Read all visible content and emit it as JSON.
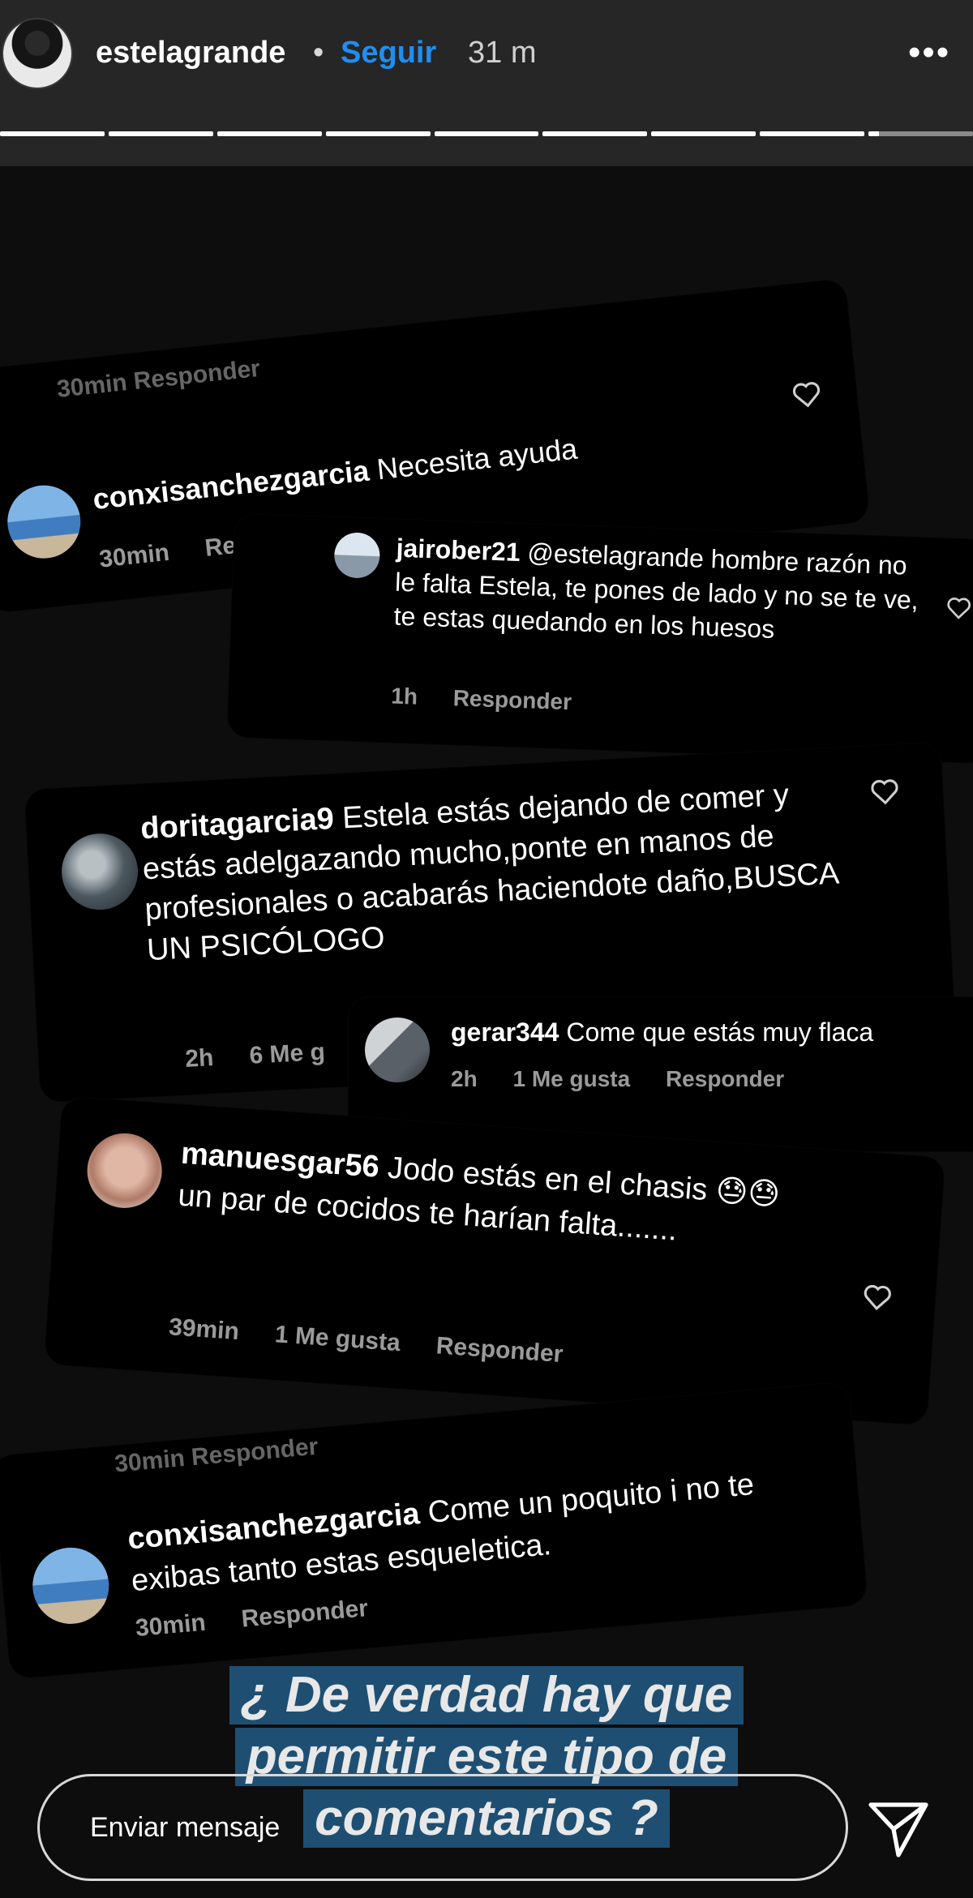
{
  "header": {
    "username": "estelagrande",
    "separator": "•",
    "follow_label": "Seguir",
    "time_ago": "31 m",
    "more_icon": "more-horizontal-icon",
    "progress_segments": 9,
    "progress_current_fraction": 0.1
  },
  "comments": [
    {
      "ghost_meta": "30min   Responder",
      "username": "conxisanchezgarcia",
      "text": "Necesita ayuda",
      "time": "30min",
      "reply_label": "Responder"
    },
    {
      "username": "jairober21",
      "text": "@estelagrande hombre razón no le falta Estela, te pones de lado y no se te ve, te estas quedando en los huesos",
      "time": "1h",
      "reply_label": "Responder"
    },
    {
      "username": "doritagarcia9",
      "text": "Estela estás dejando de comer y estás adelgazando mucho,ponte en manos de profesionales o acabarás haciendote daño,BUSCA UN PSICÓLOGO",
      "time": "2h",
      "likes": "6 Me g"
    },
    {
      "username": "gerar344",
      "text": "Come que estás muy flaca",
      "time": "2h",
      "likes": "1 Me gusta",
      "reply_label": "Responder"
    },
    {
      "username": "manuesgar56",
      "text_before": "Jodo estás en el chasis",
      "emoji": "😓😓",
      "text_after": "un par de cocidos te harían falta.......",
      "time": "39min",
      "likes": "1 Me gusta",
      "reply_label": "Responder"
    },
    {
      "ghost_meta": "30min   Responder",
      "username": "conxisanchezgarcia",
      "text": "Come un poquito i no te exibas tanto estas esqueletica.",
      "time": "30min",
      "reply_label": "Responder"
    }
  ],
  "caption": {
    "lines": [
      "¿ De verdad hay que",
      "permitir este tipo de",
      "comentarios ?"
    ],
    "background_color": "#1e4f72"
  },
  "message_bar": {
    "placeholder": "Enviar mensaje",
    "send_icon": "send-paper-plane-icon"
  }
}
